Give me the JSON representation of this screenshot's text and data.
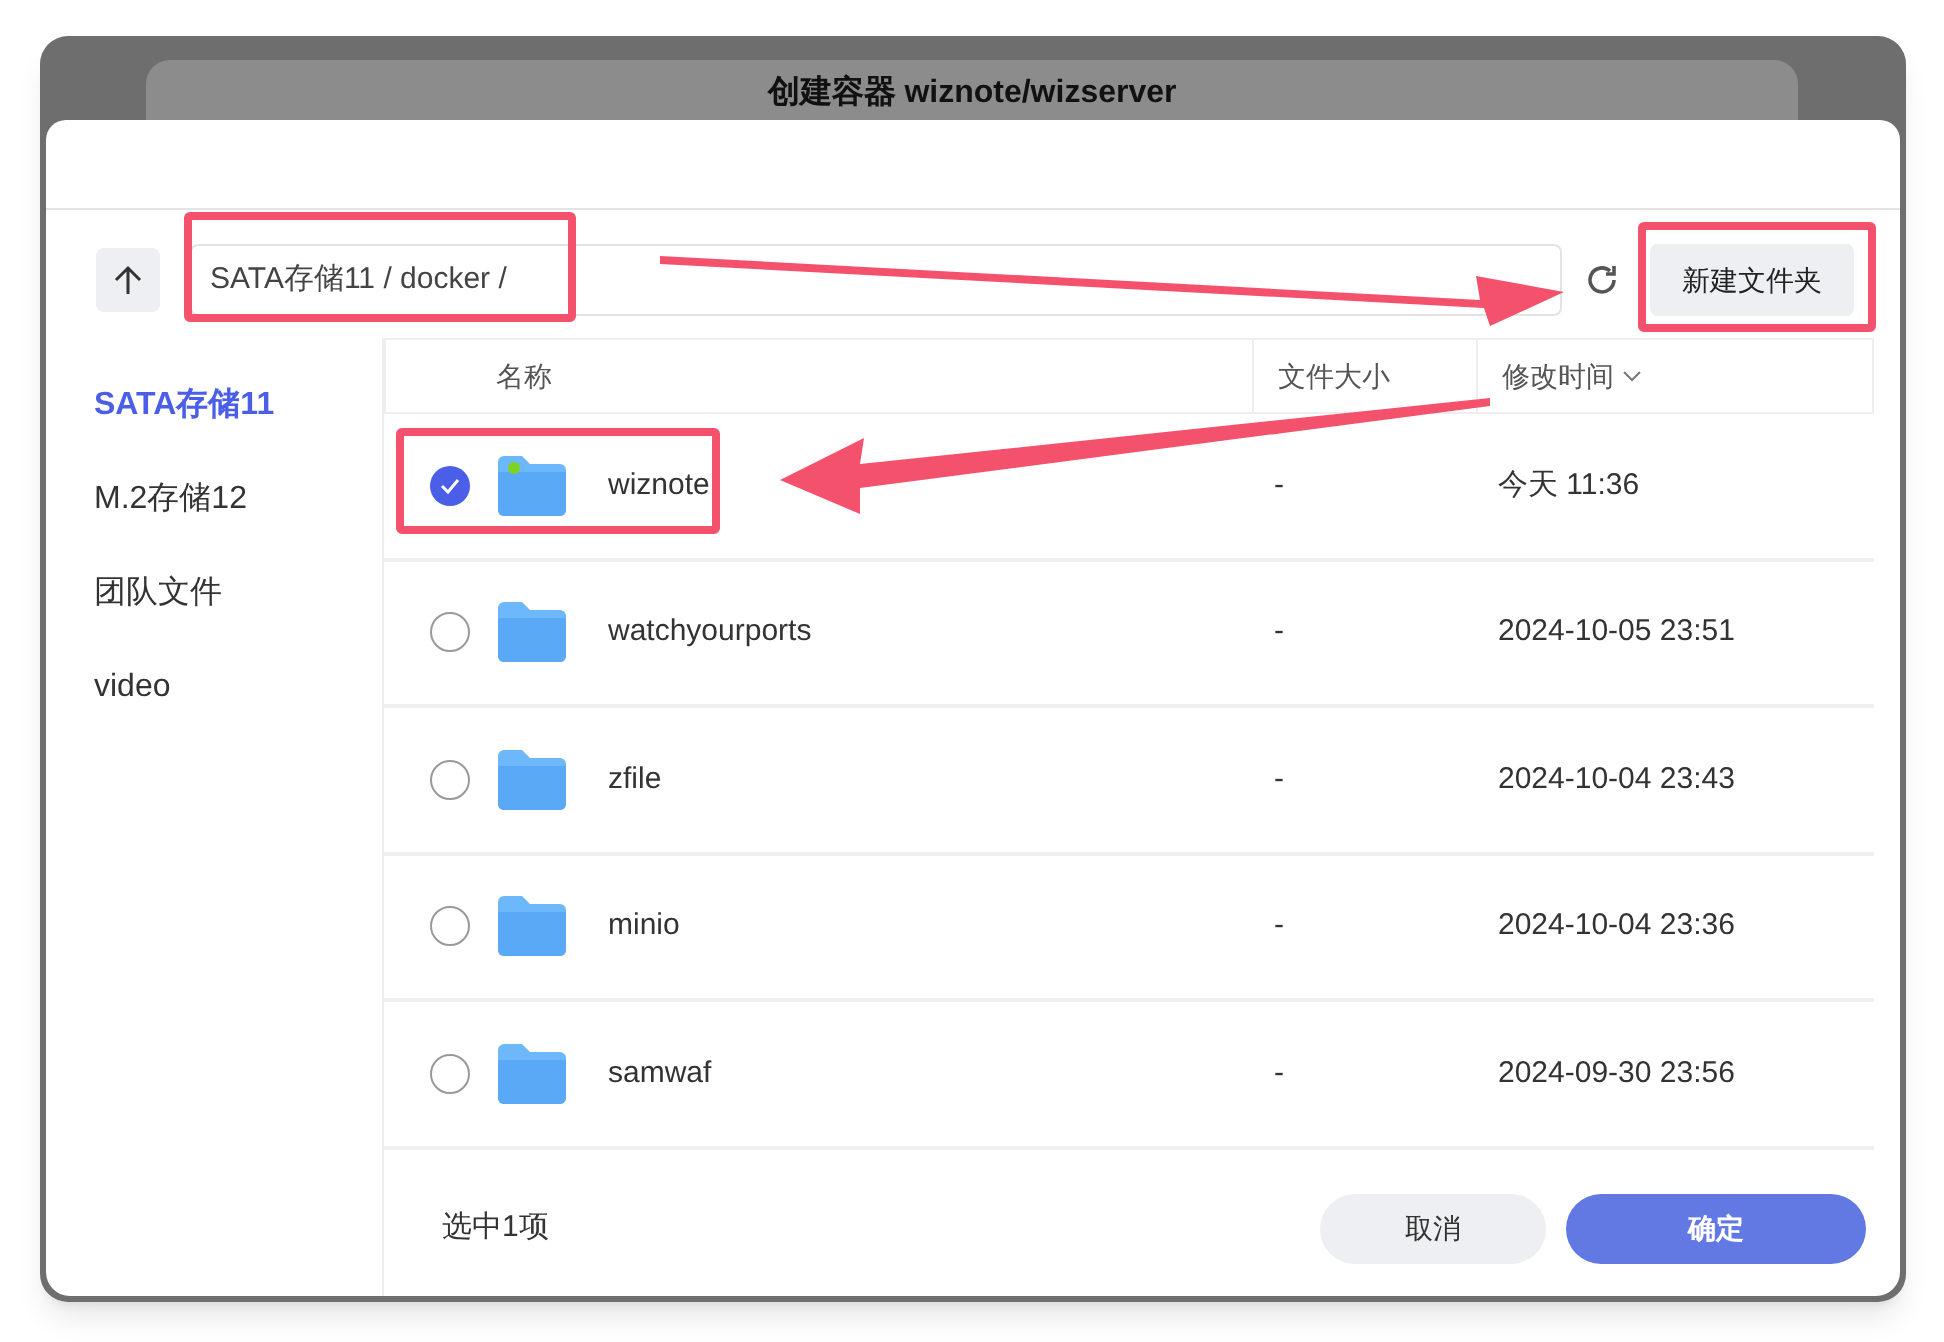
{
  "background_dialog": {
    "title": "创建容器 wiznote/wizserver"
  },
  "path_field": {
    "value": "SATA存储11 / docker /"
  },
  "new_folder_button": "新建文件夹",
  "sidebar": {
    "items": [
      {
        "label": "SATA存储11",
        "selected": true
      },
      {
        "label": "M.2存储12",
        "selected": false
      },
      {
        "label": "团队文件",
        "selected": false
      },
      {
        "label": "video",
        "selected": false
      }
    ]
  },
  "table": {
    "columns": [
      "名称",
      "文件大小",
      "修改时间"
    ],
    "rows": [
      {
        "name": "wiznote",
        "size": "-",
        "modified": "今天 11:36",
        "selected": true,
        "badge": true
      },
      {
        "name": "watchyourports",
        "size": "-",
        "modified": "2024-10-05 23:51",
        "selected": false,
        "badge": false
      },
      {
        "name": "zfile",
        "size": "-",
        "modified": "2024-10-04 23:43",
        "selected": false,
        "badge": false
      },
      {
        "name": "minio",
        "size": "-",
        "modified": "2024-10-04 23:36",
        "selected": false,
        "badge": false
      },
      {
        "name": "samwaf",
        "size": "-",
        "modified": "2024-09-30 23:56",
        "selected": false,
        "badge": false
      }
    ]
  },
  "footer": {
    "selection_count": "选中1项",
    "buttons": [
      {
        "label": "取消",
        "kind": "secondary"
      },
      {
        "label": "确定",
        "kind": "primary"
      }
    ]
  }
}
